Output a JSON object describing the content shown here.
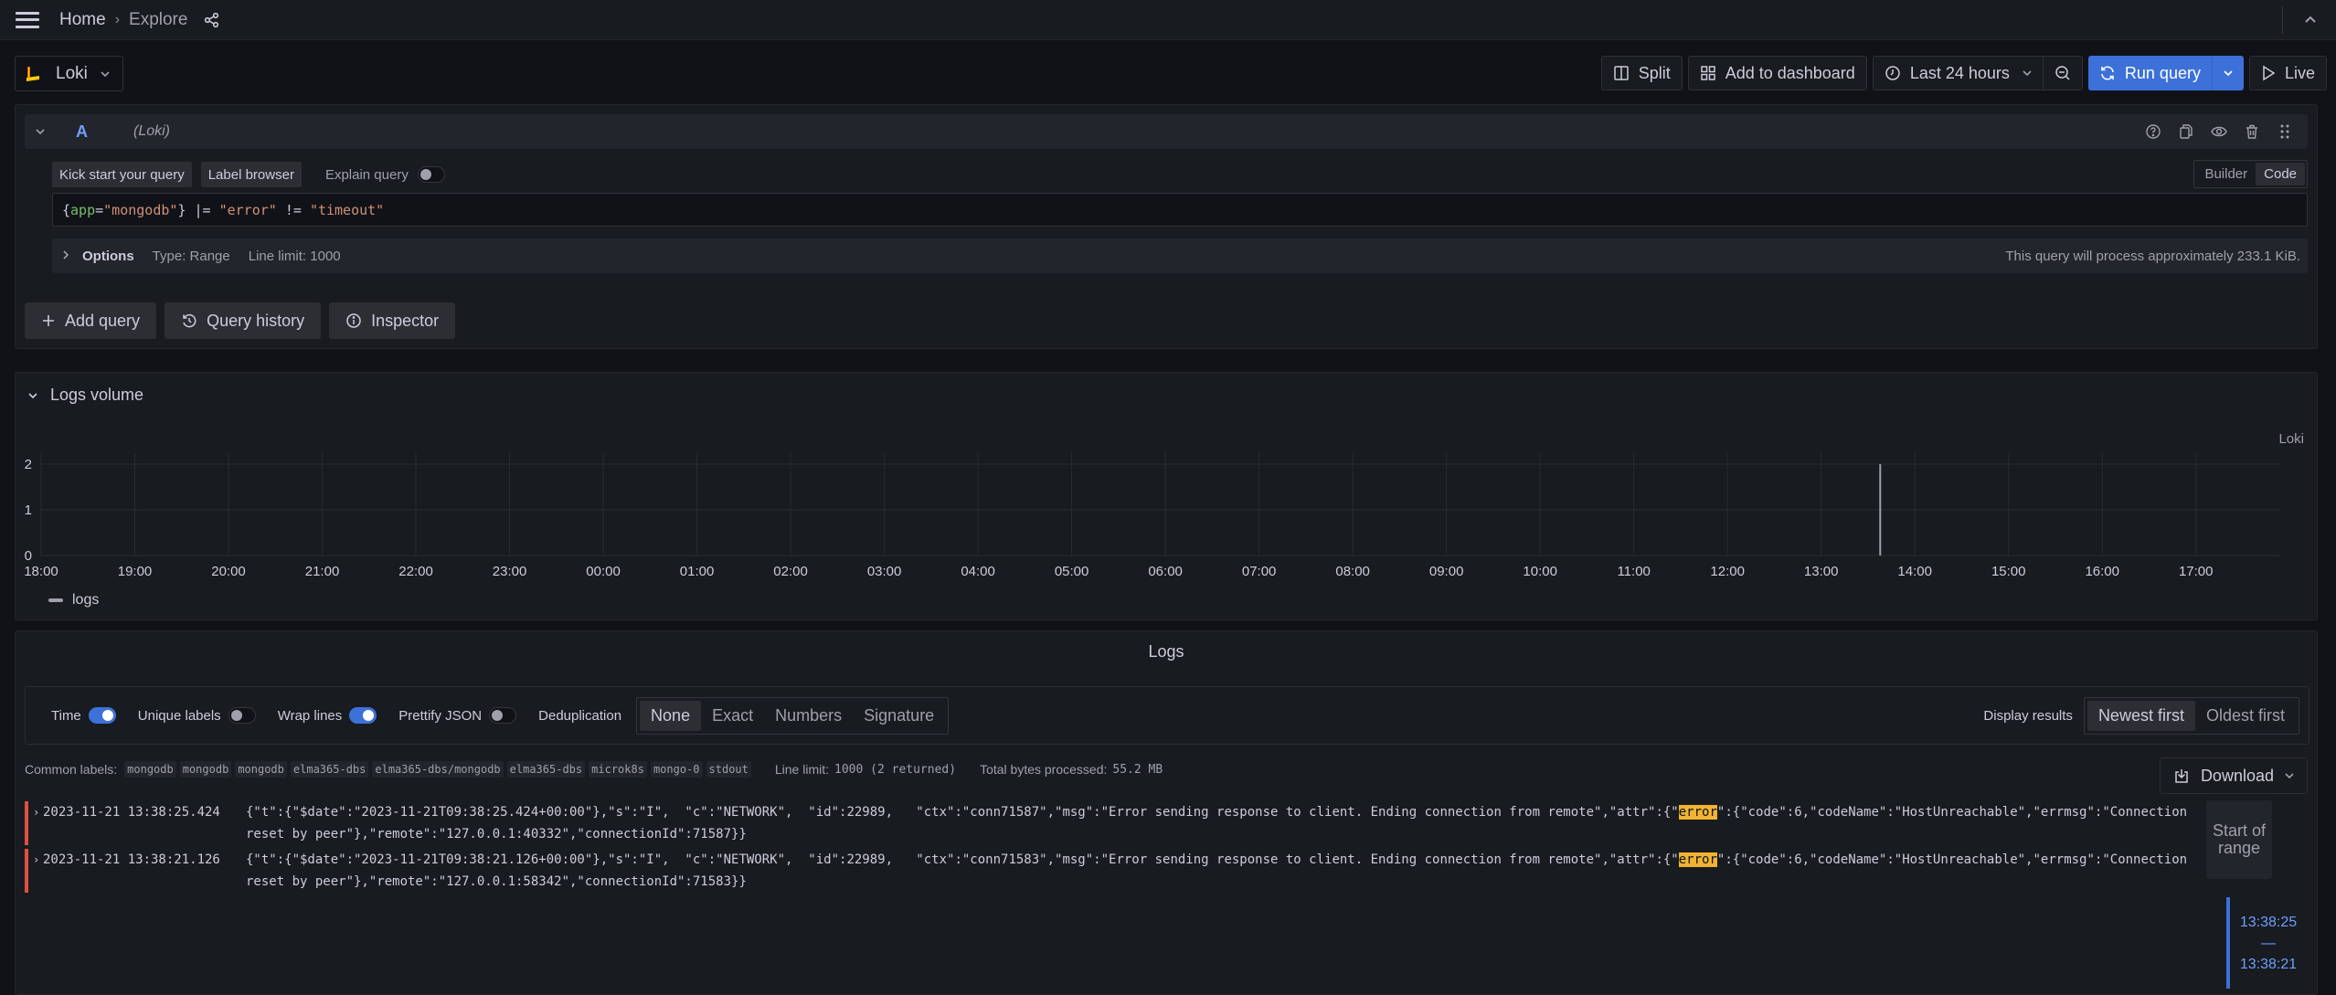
{
  "topbar": {
    "breadcrumb_home": "Home",
    "breadcrumb_sep": "›",
    "breadcrumb_current": "Explore",
    "collapse_icon": "chevron-up-icon",
    "collapse_glyph": "^"
  },
  "toolbar": {
    "datasource": "Loki",
    "datasource_chevron": "⌄",
    "split_label": "Split",
    "add_to_dashboard_label": "Add to dashboard",
    "time_range_label": "Last 24 hours",
    "time_chevron": "⌄",
    "run_query_label": "Run query",
    "run_chevron": "⌄",
    "live_label": "Live"
  },
  "query": {
    "collapse_chevron": "⌄",
    "ref_id": "A",
    "datasource": "(Loki)",
    "kick_start_label": "Kick start your query",
    "label_browser_label": "Label browser",
    "explain_label": "Explain query",
    "explain_on": false,
    "mode_builder": "Builder",
    "mode_code": "Code",
    "active_mode": "Code",
    "expression_tokens": [
      {
        "t": "{",
        "c": "tok-brace"
      },
      {
        "t": "app",
        "c": "tok-key"
      },
      {
        "t": "=",
        "c": "tok-op"
      },
      {
        "t": "\"mongodb\"",
        "c": "tok-str"
      },
      {
        "t": "} ",
        "c": "tok-brace"
      },
      {
        "t": "|= ",
        "c": "tok-op"
      },
      {
        "t": "\"error\"",
        "c": "tok-str"
      },
      {
        "t": " != ",
        "c": "tok-op"
      },
      {
        "t": "\"timeout\"",
        "c": "tok-str"
      }
    ],
    "options_chevron": "›",
    "options_label": "Options",
    "type_label": "Type: Range",
    "line_limit_label": "Line limit: 1000",
    "process_estimate": "This query will process approximately 233.1 KiB.",
    "add_query_label": "Add query",
    "add_query_glyph": "+",
    "query_history_label": "Query history",
    "inspector_label": "Inspector"
  },
  "logs_volume": {
    "chevron": "⌄",
    "title": "Logs volume",
    "datasource_label": "Loki",
    "legend_label": "logs"
  },
  "chart_data": {
    "type": "bar",
    "title": "Logs volume",
    "xlabel": "",
    "ylabel": "",
    "x_ticks": [
      "18:00",
      "19:00",
      "20:00",
      "21:00",
      "22:00",
      "23:00",
      "00:00",
      "01:00",
      "02:00",
      "03:00",
      "04:00",
      "05:00",
      "06:00",
      "07:00",
      "08:00",
      "09:00",
      "10:00",
      "11:00",
      "12:00",
      "13:00",
      "14:00",
      "15:00",
      "16:00",
      "17:00"
    ],
    "y_ticks": [
      0,
      1,
      2
    ],
    "ylim": [
      0,
      2
    ],
    "x_range_hours": [
      0,
      23.9
    ],
    "grid": true,
    "legend": "bottom-left",
    "series": [
      {
        "name": "logs",
        "color": "#9fa0ab",
        "points": [
          {
            "x": "13:38",
            "x_hours": 19.63,
            "y": 2
          }
        ]
      }
    ]
  },
  "logs": {
    "title": "Logs",
    "options": {
      "time_label": "Time",
      "time_on": true,
      "unique_labels_label": "Unique labels",
      "unique_labels_on": false,
      "wrap_lines_label": "Wrap lines",
      "wrap_lines_on": true,
      "prettify_json_label": "Prettify JSON",
      "prettify_json_on": false,
      "dedup_label": "Deduplication",
      "dedup_options": [
        "None",
        "Exact",
        "Numbers",
        "Signature"
      ],
      "dedup_active": "None",
      "display_results_label": "Display results",
      "order_options": [
        "Newest first",
        "Oldest first"
      ],
      "order_active": "Newest first"
    },
    "common_labels_label": "Common labels:",
    "common_labels": [
      "mongodb",
      "mongodb",
      "mongodb",
      "elma365-dbs",
      "elma365-dbs/mongodb",
      "elma365-dbs",
      "microk8s",
      "mongo-0",
      "stdout"
    ],
    "line_limit_label": "Line limit:",
    "line_limit_value": "1000 (2 returned)",
    "bytes_label": "Total bytes processed:",
    "bytes_value": "55.2 MB",
    "download_label": "Download",
    "download_chevron": "⌄",
    "level_color": "#e0503d",
    "rows": [
      {
        "expand_glyph": "›",
        "timestamp": "2023-11-21 13:38:25.424",
        "line_before": "{\"t\":{\"$date\":\"2023-11-21T09:38:25.424+00:00\"},\"s\":\"I\",  \"c\":\"NETWORK\",  \"id\":22989,   \"ctx\":\"conn71587\",\"msg\":\"Error sending response to client. Ending connection from remote\",\"attr\":{\"",
        "highlight": "error",
        "line_after": "\":{\"code\":6,\"codeName\":\"HostUnreachable\",\"errmsg\":\"Connection reset by peer\"},\"remote\":\"127.0.0.1:40332\",\"connectionId\":71587}}"
      },
      {
        "expand_glyph": "›",
        "timestamp": "2023-11-21 13:38:21.126",
        "line_before": "{\"t\":{\"$date\":\"2023-11-21T09:38:21.126+00:00\"},\"s\":\"I\",  \"c\":\"NETWORK\",  \"id\":22989,   \"ctx\":\"conn71583\",\"msg\":\"Error sending response to client. Ending connection from remote\",\"attr\":{\"",
        "highlight": "error",
        "line_after": "\":{\"code\":6,\"codeName\":\"HostUnreachable\",\"errmsg\":\"Connection reset by peer\"},\"remote\":\"127.0.0.1:58342\",\"connectionId\":71583}}"
      }
    ],
    "start_of_range_label": "Start of range",
    "range_start": "13:38:25",
    "range_sep": "—",
    "range_end": "13:38:21"
  }
}
